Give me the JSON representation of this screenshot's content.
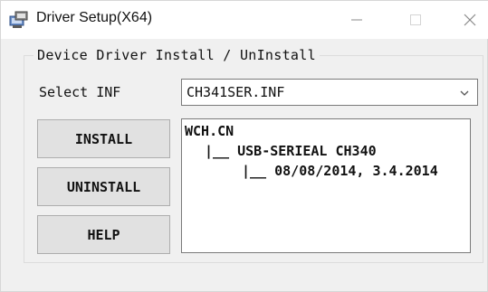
{
  "window": {
    "title": "Driver Setup(X64)",
    "icon": "driver-setup-icon",
    "controls": {
      "minimize": "minimize-icon",
      "maximize": "maximize-icon",
      "close": "close-icon"
    }
  },
  "group": {
    "title": "Device Driver Install / UnInstall"
  },
  "select_inf": {
    "label": "Select INF",
    "value": "CH341SER.INF"
  },
  "buttons": {
    "install": "INSTALL",
    "uninstall": "UNINSTALL",
    "help": "HELP"
  },
  "info": {
    "lines": [
      "WCH.CN",
      "|__ USB-SERIEAL CH340",
      "|__ 08/08/2014, 3.4.2014"
    ]
  },
  "colors": {
    "window_bg": "#f0f0f0",
    "titlebar_bg": "#ffffff",
    "button_bg": "#e1e1e1",
    "border": "#adadad"
  }
}
